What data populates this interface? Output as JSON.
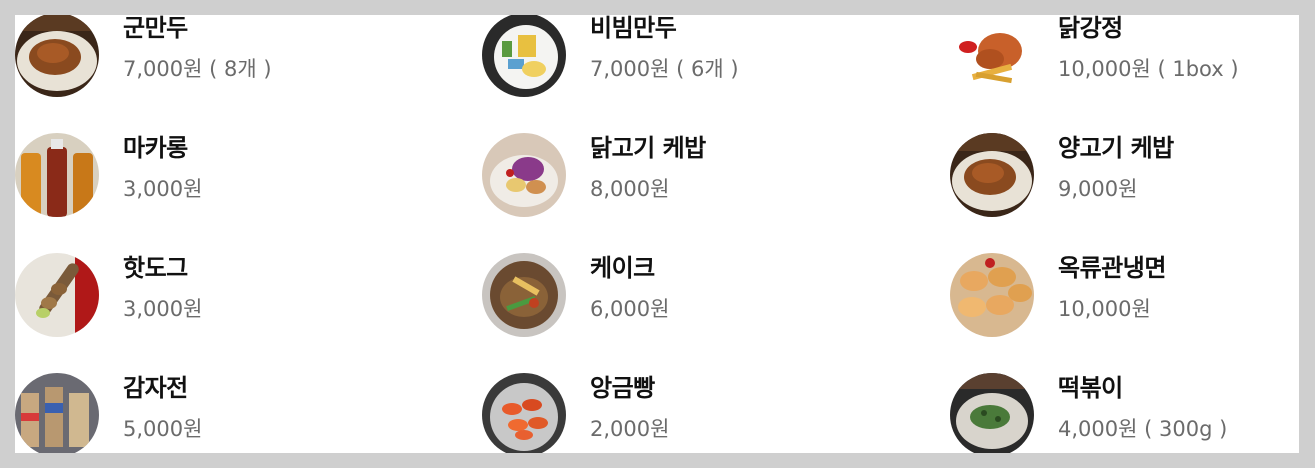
{
  "menu": {
    "items": [
      {
        "name": "군만두",
        "price": "7,000원 ( 8개 )",
        "thumb": "food-photo-fried-cutlet-icon"
      },
      {
        "name": "비빔만두",
        "price": "7,000원 ( 6개 )",
        "thumb": "food-photo-plated-dish-icon"
      },
      {
        "name": "닭강정",
        "price": "10,000원 ( 1box )",
        "thumb": "food-photo-fried-chicken-icon"
      },
      {
        "name": "마카롱",
        "price": "3,000원",
        "thumb": "food-photo-drink-bottles-icon"
      },
      {
        "name": "닭고기 케밥",
        "price": "8,000원",
        "thumb": "food-photo-salad-icon"
      },
      {
        "name": "양고기 케밥",
        "price": "9,000원",
        "thumb": "food-photo-fried-cutlet-icon"
      },
      {
        "name": "핫도그",
        "price": "3,000원",
        "thumb": "food-photo-skewer-icon"
      },
      {
        "name": "케이크",
        "price": "6,000원",
        "thumb": "food-photo-stir-fry-icon"
      },
      {
        "name": "옥류관냉면",
        "price": "10,000원",
        "thumb": "food-photo-dumplings-icon"
      },
      {
        "name": "감자전",
        "price": "5,000원",
        "thumb": "food-photo-snack-bags-icon"
      },
      {
        "name": "앙금빵",
        "price": "2,000원",
        "thumb": "food-photo-shrimp-icon"
      },
      {
        "name": "떡볶이",
        "price": "4,000원 ( 300g )",
        "thumb": "food-photo-soup-bowl-icon"
      }
    ]
  },
  "colors": {
    "background": "#cfcfcf",
    "panel": "#ffffff",
    "name_text": "#111111",
    "price_text": "#6b6b6b"
  }
}
